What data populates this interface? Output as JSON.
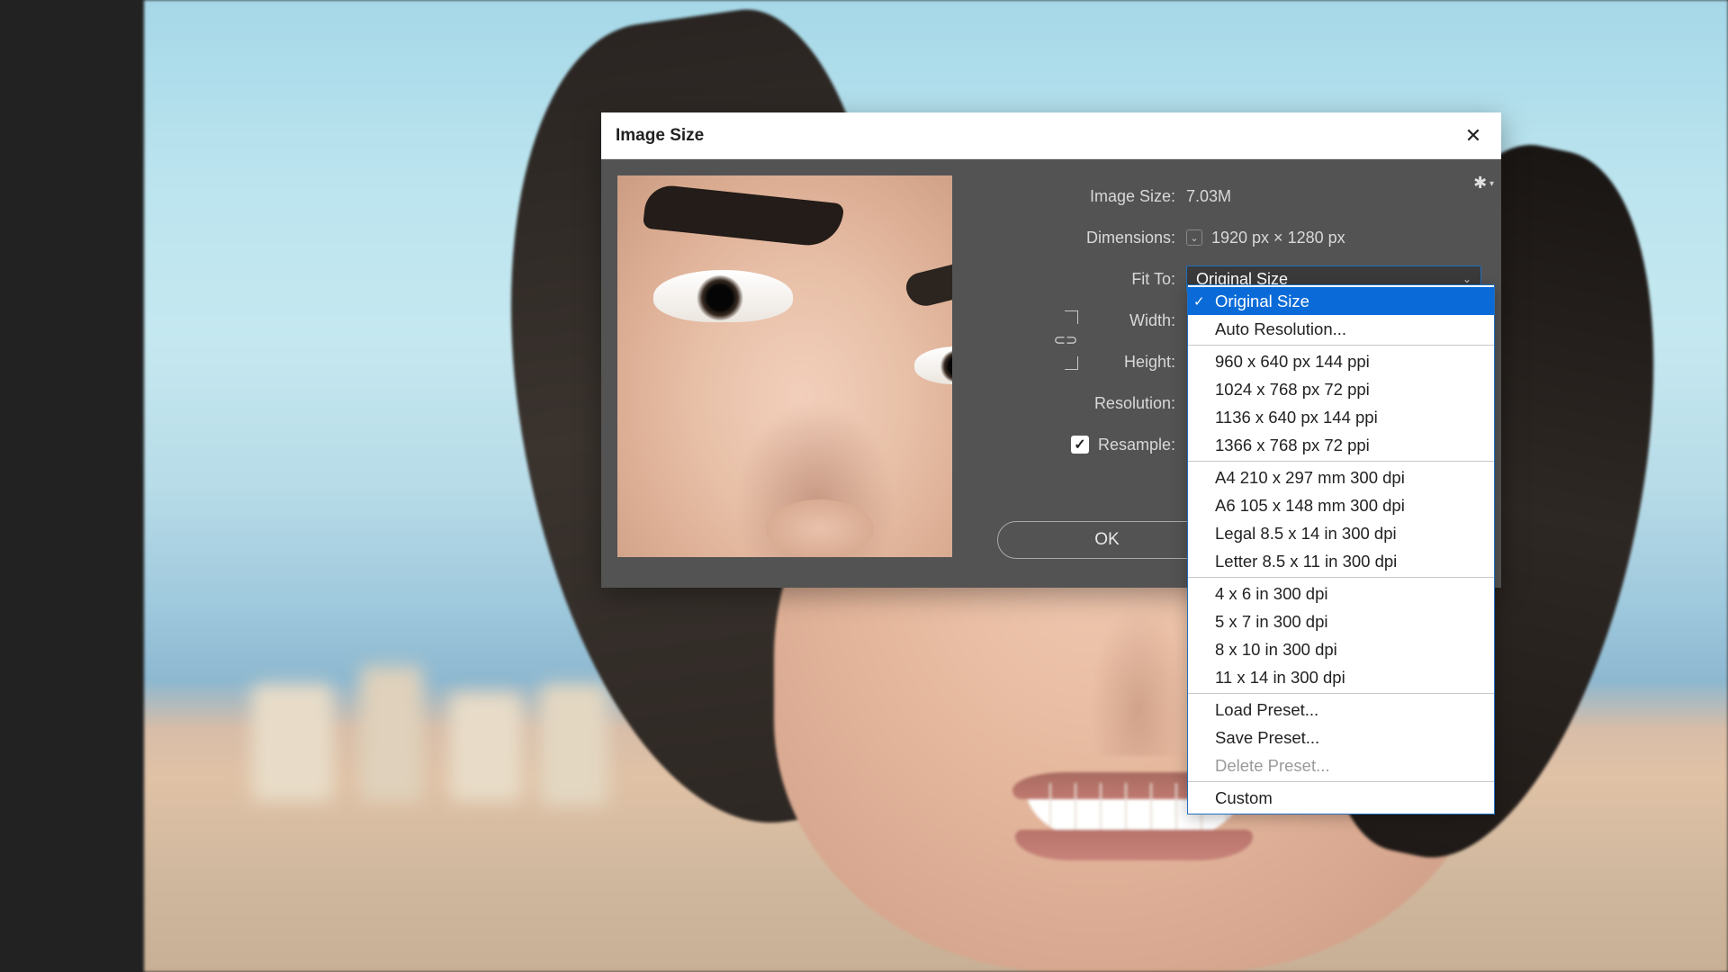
{
  "dialog": {
    "title": "Image Size",
    "image_size_label": "Image Size:",
    "image_size_value": "7.03M",
    "dimensions_label": "Dimensions:",
    "dimensions_value": "1920 px  ×  1280 px",
    "fit_to_label": "Fit To:",
    "fit_to_value": "Original Size",
    "width_label": "Width:",
    "height_label": "Height:",
    "resolution_label": "Resolution:",
    "resample_label": "Resample:",
    "ok_button": "OK"
  },
  "dropdown": {
    "sections": [
      [
        {
          "label": "Original Size",
          "selected": true
        },
        {
          "label": "Auto Resolution...",
          "selected": false
        }
      ],
      [
        {
          "label": "960 x 640 px 144 ppi"
        },
        {
          "label": "1024 x 768 px 72 ppi"
        },
        {
          "label": "1136 x 640 px 144 ppi"
        },
        {
          "label": "1366 x 768 px 72 ppi"
        }
      ],
      [
        {
          "label": "A4 210 x 297 mm 300 dpi"
        },
        {
          "label": "A6 105 x 148 mm 300 dpi"
        },
        {
          "label": "Legal 8.5 x 14 in 300 dpi"
        },
        {
          "label": "Letter 8.5 x 11 in 300 dpi"
        }
      ],
      [
        {
          "label": "4 x 6 in 300 dpi"
        },
        {
          "label": "5 x 7 in 300 dpi"
        },
        {
          "label": "8 x 10 in 300 dpi"
        },
        {
          "label": "11 x 14 in 300 dpi"
        }
      ],
      [
        {
          "label": "Load Preset..."
        },
        {
          "label": "Save Preset..."
        },
        {
          "label": "Delete Preset...",
          "disabled": true
        }
      ],
      [
        {
          "label": "Custom"
        }
      ]
    ]
  }
}
